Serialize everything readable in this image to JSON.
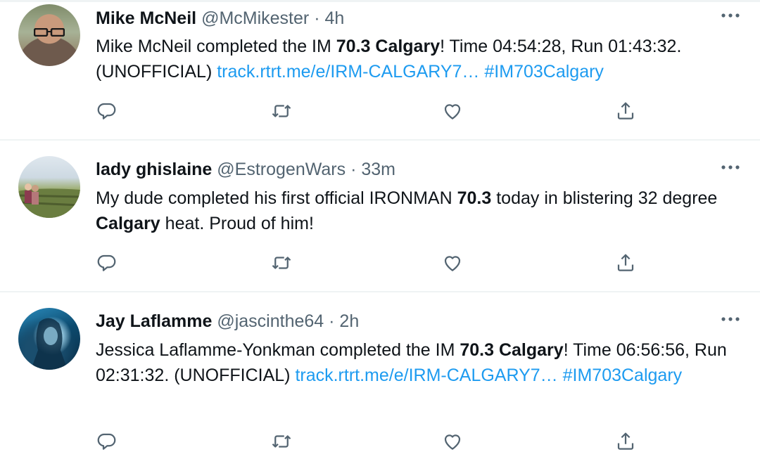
{
  "tweets": [
    {
      "name": "Mike McNeil",
      "handle": "@McMikester",
      "separator": "·",
      "time": "4h",
      "body": [
        {
          "text": "Mike McNeil completed the IM "
        },
        {
          "text": "70.3 Calgary",
          "style": "bold"
        },
        {
          "text": "! Time 04:54:28, Run 01:43:32. (UNOFFICIAL) "
        },
        {
          "text": "track.rtrt.me/e/IRM-CALGARY7…",
          "style": "link"
        },
        {
          "text": " "
        },
        {
          "text": "#IM703Calgary",
          "style": "link"
        }
      ]
    },
    {
      "name": "lady ghislaine",
      "handle": "@EstrogenWars",
      "separator": "·",
      "time": "33m",
      "body": [
        {
          "text": "My dude completed his first official IRONMAN "
        },
        {
          "text": "70.3",
          "style": "bold"
        },
        {
          "text": " today in blistering 32 degree "
        },
        {
          "text": "Calgary",
          "style": "bold"
        },
        {
          "text": " heat. Proud of him!"
        }
      ]
    },
    {
      "name": "Jay Laflamme",
      "handle": "@jascinthe64",
      "separator": "·",
      "time": "2h",
      "body": [
        {
          "text": "Jessica Laflamme-Yonkman completed the IM "
        },
        {
          "text": "70.3 Calgary",
          "style": "bold"
        },
        {
          "text": "! Time 06:56:56, Run 02:31:32. (UNOFFICIAL) "
        },
        {
          "text": "track.rtrt.me/e/IRM-CALGARY7…",
          "style": "link"
        },
        {
          "text": " "
        },
        {
          "text": "#IM703Calgary",
          "style": "link"
        }
      ]
    }
  ],
  "icons": {
    "more": "more-horizontal-icon",
    "reply": "reply-icon",
    "retweet": "retweet-icon",
    "like": "heart-icon",
    "share": "share-icon"
  },
  "colors": {
    "text": "#0f1419",
    "secondary": "#536471",
    "link": "#1d9bf0",
    "divider": "#eff3f4"
  }
}
